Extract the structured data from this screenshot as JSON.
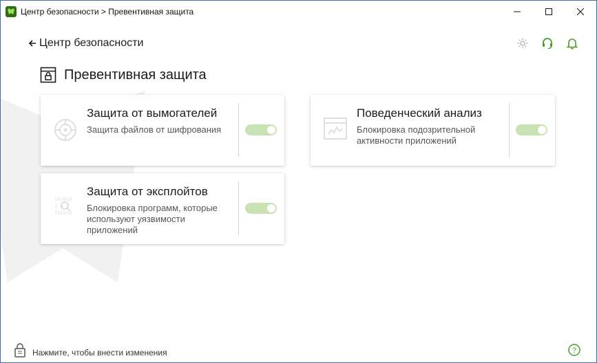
{
  "window": {
    "title": "Центр безопасности > Превентивная защита"
  },
  "header": {
    "back_label": "Центр безопасности",
    "page_title": "Превентивная защита",
    "icons": [
      "gear-icon",
      "support-headset-icon",
      "bell-icon"
    ]
  },
  "cards": [
    {
      "title": "Защита от вымогателей",
      "description": "Защита файлов от шифрования",
      "icon": "ransomware-shield-icon",
      "enabled": true
    },
    {
      "title": "Поведенческий анализ",
      "description": "Блокировка подозрительной активности приложений",
      "icon": "behavior-analysis-icon",
      "enabled": true
    },
    {
      "title": "Защита от эксплойтов",
      "description": "Блокировка программ, которые используют уязвимости приложений",
      "icon": "exploit-binary-icon",
      "enabled": true
    }
  ],
  "footer": {
    "lock_text": "Нажмите, чтобы внести изменения"
  },
  "colors": {
    "accent": "#4a9d2a",
    "toggle_disabled_on": "#c9e2b4",
    "title_bar_border": "#3a6ea5"
  }
}
